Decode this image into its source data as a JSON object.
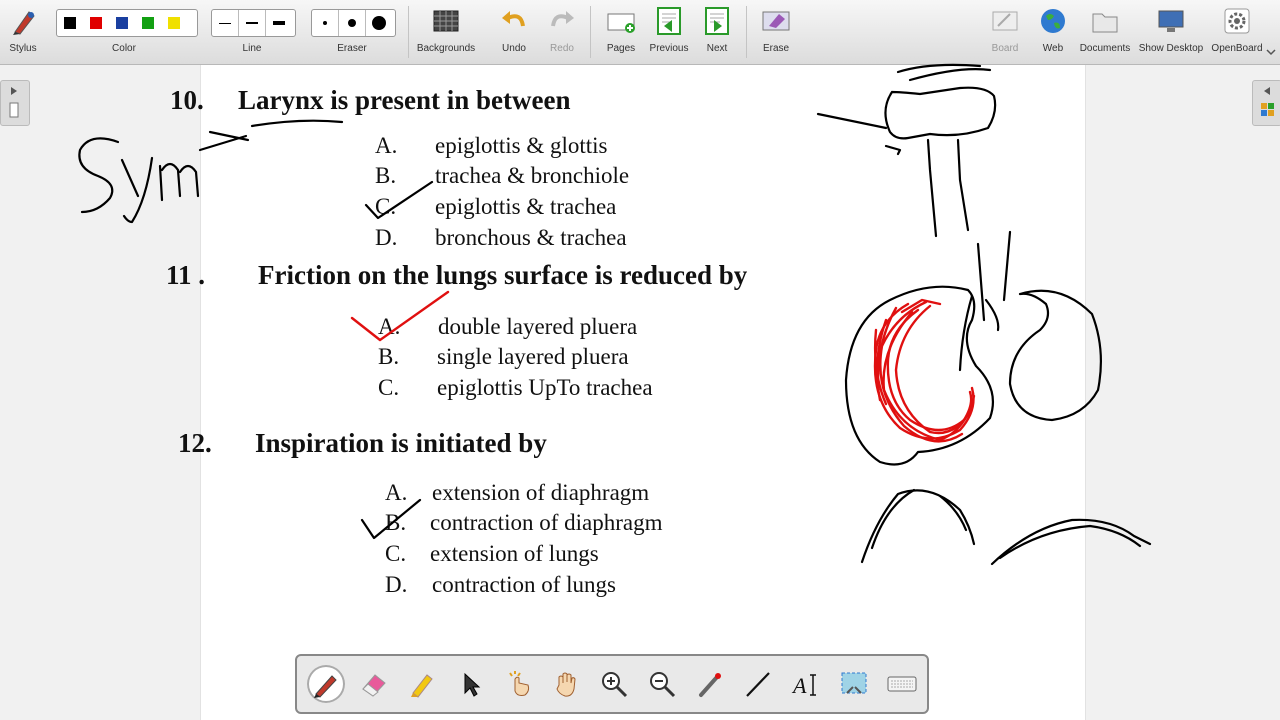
{
  "toolbar": {
    "stylus": "Stylus",
    "color": "Color",
    "line": "Line",
    "eraser": "Eraser",
    "backgrounds": "Backgrounds",
    "undo": "Undo",
    "redo": "Redo",
    "pages": "Pages",
    "previous": "Previous",
    "next": "Next",
    "erase": "Erase",
    "board": "Board",
    "web": "Web",
    "documents": "Documents",
    "show_desktop": "Show Desktop",
    "openboard": "OpenBoard",
    "colors": [
      "#000000",
      "#e00000",
      "#1a3fa0",
      "#12a012",
      "#f0e000"
    ]
  },
  "questions": [
    {
      "number": "10.",
      "pre": "",
      "underlined": "Larynx",
      "post": " is present in between",
      "options": [
        {
          "letter": "A.",
          "text": "epiglottis & glottis"
        },
        {
          "letter": "B.",
          "text": "trachea & bronchiole"
        },
        {
          "letter": "C.",
          "text": "epiglottis & trachea"
        },
        {
          "letter": "D.",
          "text": "bronchous & trachea"
        }
      ]
    },
    {
      "number": "11 .",
      "text": "Friction on the lungs surface is reduced by",
      "options": [
        {
          "letter": "A.",
          "text": "double layered pluera"
        },
        {
          "letter": "B.",
          "text": "single layered pluera"
        },
        {
          "letter": "C.",
          "text": "epiglottis UpTo trachea"
        }
      ]
    },
    {
      "number": "12.",
      "text": "Inspiration is initiated by",
      "options": [
        {
          "letter": "A.",
          "text": "extension of diaphragm"
        },
        {
          "letter": "B.",
          "text": "contraction of diaphragm"
        },
        {
          "letter": "C.",
          "text": "extension of lungs"
        },
        {
          "letter": "D.",
          "text": "contraction of lungs"
        }
      ]
    }
  ],
  "ink": {
    "handwriting": "Synx",
    "black": "#000000",
    "red": "#e01010"
  },
  "dock": {
    "tools": [
      "pen-icon",
      "eraser-icon",
      "highlighter-icon",
      "select-icon",
      "interact-icon",
      "hand-icon",
      "zoom-in-icon",
      "zoom-out-icon",
      "laser-icon",
      "line-icon",
      "text-icon",
      "capture-icon",
      "keyboard-icon"
    ],
    "active": "pen-icon"
  }
}
